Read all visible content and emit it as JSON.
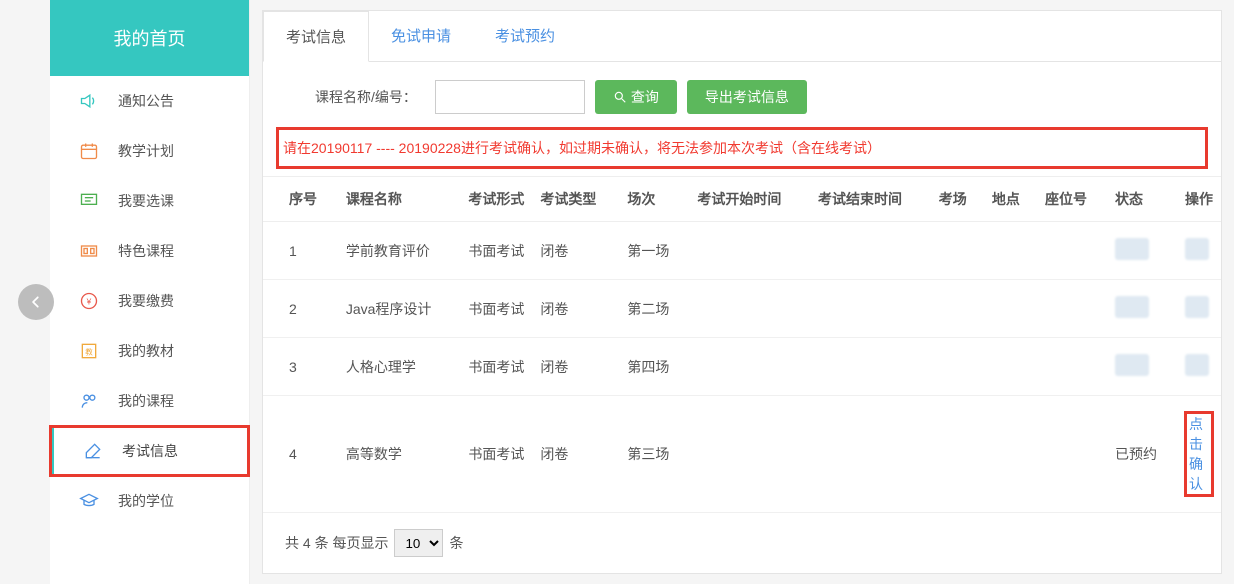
{
  "sidebar": {
    "home": "我的首页",
    "items": [
      {
        "label": "通知公告",
        "icon": "speaker-icon",
        "color": "#35c7c0"
      },
      {
        "label": "教学计划",
        "icon": "calendar-icon",
        "color": "#f08b4a"
      },
      {
        "label": "我要选课",
        "icon": "board-icon",
        "color": "#4caf50"
      },
      {
        "label": "特色课程",
        "icon": "puzzle-icon",
        "color": "#f08b4a"
      },
      {
        "label": "我要缴费",
        "icon": "money-icon",
        "color": "#e8584b"
      },
      {
        "label": "我的教材",
        "icon": "book-icon",
        "color": "#f0a93c"
      },
      {
        "label": "我的课程",
        "icon": "course-icon",
        "color": "#4a90e2"
      },
      {
        "label": "考试信息",
        "icon": "edit-icon",
        "color": "#4a90e2",
        "active": true
      },
      {
        "label": "我的学位",
        "icon": "cap-icon",
        "color": "#4a90e2"
      }
    ]
  },
  "tabs": [
    {
      "label": "考试信息",
      "active": true
    },
    {
      "label": "免试申请"
    },
    {
      "label": "考试预约"
    }
  ],
  "search": {
    "label": "课程名称/编号：",
    "value": "",
    "query_btn": "查询",
    "export_btn": "导出考试信息"
  },
  "alert": "请在20190117 ---- 20190228进行考试确认，如过期未确认，将无法参加本次考试（含在线考试）",
  "columns": [
    "序号",
    "课程名称",
    "考试形式",
    "考试类型",
    "场次",
    "考试开始时间",
    "考试结束时间",
    "考场",
    "地点",
    "座位号",
    "状态",
    "操作"
  ],
  "rows": [
    {
      "no": "1",
      "course": "学前教育评价",
      "form": "书面考试",
      "type": "闭卷",
      "session": "第一场",
      "start": "",
      "end": "",
      "room": "",
      "place": "",
      "seat": "",
      "status": "",
      "op": ""
    },
    {
      "no": "2",
      "course": "Java程序设计",
      "form": "书面考试",
      "type": "闭卷",
      "session": "第二场",
      "start": "",
      "end": "",
      "room": "",
      "place": "",
      "seat": "",
      "status": "",
      "op": ""
    },
    {
      "no": "3",
      "course": "人格心理学",
      "form": "书面考试",
      "type": "闭卷",
      "session": "第四场",
      "start": "",
      "end": "",
      "room": "",
      "place": "",
      "seat": "",
      "status": "",
      "op": ""
    },
    {
      "no": "4",
      "course": "高等数学",
      "form": "书面考试",
      "type": "闭卷",
      "session": "第三场",
      "start": "",
      "end": "",
      "room": "",
      "place": "",
      "seat": "",
      "status": "已预约",
      "op": "点击确认",
      "op_link": true
    }
  ],
  "pager": {
    "prefix": "共 4 条 每页显示",
    "size": "10",
    "suffix": "条"
  }
}
